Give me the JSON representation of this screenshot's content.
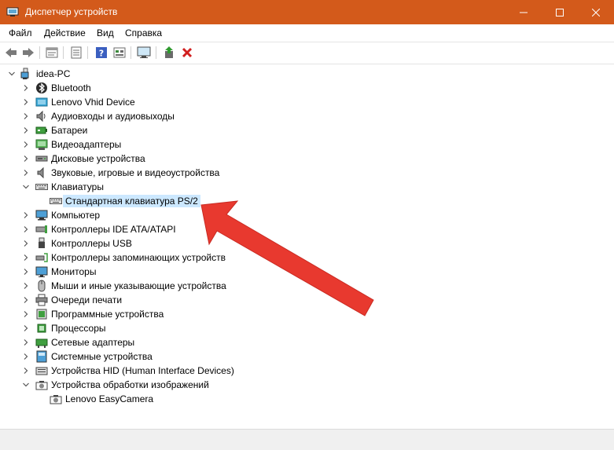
{
  "window": {
    "title": "Диспетчер устройств"
  },
  "menu": [
    "Файл",
    "Действие",
    "Вид",
    "Справка"
  ],
  "toolbar": {
    "buttons": [
      {
        "name": "back-button",
        "icon": "arrow-left-icon"
      },
      {
        "name": "forward-button",
        "icon": "arrow-right-icon"
      },
      {
        "name": "properties-button",
        "icon": "properties-icon"
      },
      {
        "name": "update-list-button",
        "icon": "list-icon"
      },
      {
        "name": "help-button",
        "icon": "help-icon"
      },
      {
        "name": "show-hidden-button",
        "icon": "view-icon"
      },
      {
        "name": "scan-hardware-button",
        "icon": "monitor-scan-icon"
      },
      {
        "name": "update-driver-button",
        "icon": "update-driver-icon"
      },
      {
        "name": "uninstall-device-button",
        "icon": "red-x-icon"
      }
    ]
  },
  "tree": {
    "root": "idea-PC",
    "items": [
      {
        "label": "Bluetooth",
        "icon": "bluetooth-icon",
        "expanded": false
      },
      {
        "label": "Lenovo Vhid Device",
        "icon": "device-icon",
        "expanded": false
      },
      {
        "label": "Аудиовходы и аудиовыходы",
        "icon": "speaker-icon",
        "expanded": false
      },
      {
        "label": "Батареи",
        "icon": "battery-icon",
        "expanded": false
      },
      {
        "label": "Видеоадаптеры",
        "icon": "display-adapter-icon",
        "expanded": false
      },
      {
        "label": "Дисковые устройства",
        "icon": "disk-drive-icon",
        "expanded": false
      },
      {
        "label": "Звуковые, игровые и видеоустройства",
        "icon": "sound-icon",
        "expanded": false
      },
      {
        "label": "Клавиатуры",
        "icon": "keyboard-icon",
        "expanded": true,
        "children": [
          {
            "label": "Стандартная клавиатура PS/2",
            "icon": "keyboard-icon",
            "selected": true
          }
        ]
      },
      {
        "label": "Компьютер",
        "icon": "computer-icon",
        "expanded": false
      },
      {
        "label": "Контроллеры IDE ATA/ATAPI",
        "icon": "ide-controller-icon",
        "expanded": false
      },
      {
        "label": "Контроллеры USB",
        "icon": "usb-icon",
        "expanded": false
      },
      {
        "label": "Контроллеры запоминающих устройств",
        "icon": "storage-controller-icon",
        "expanded": false
      },
      {
        "label": "Мониторы",
        "icon": "monitor-icon",
        "expanded": false
      },
      {
        "label": "Мыши и иные указывающие устройства",
        "icon": "mouse-icon",
        "expanded": false
      },
      {
        "label": "Очереди печати",
        "icon": "printer-icon",
        "expanded": false
      },
      {
        "label": "Программные устройства",
        "icon": "software-device-icon",
        "expanded": false
      },
      {
        "label": "Процессоры",
        "icon": "processor-icon",
        "expanded": false
      },
      {
        "label": "Сетевые адаптеры",
        "icon": "network-adapter-icon",
        "expanded": false
      },
      {
        "label": "Системные устройства",
        "icon": "system-device-icon",
        "expanded": false
      },
      {
        "label": "Устройства HID (Human Interface Devices)",
        "icon": "hid-icon",
        "expanded": false
      },
      {
        "label": "Устройства обработки изображений",
        "icon": "camera-icon",
        "expanded": true,
        "children": [
          {
            "label": "Lenovo EasyCamera",
            "icon": "camera-icon",
            "selected": false
          }
        ]
      }
    ]
  },
  "colors": {
    "titlebar": "#D35A1B",
    "selection": "#CCE8FF",
    "arrow": "#E8392F"
  }
}
